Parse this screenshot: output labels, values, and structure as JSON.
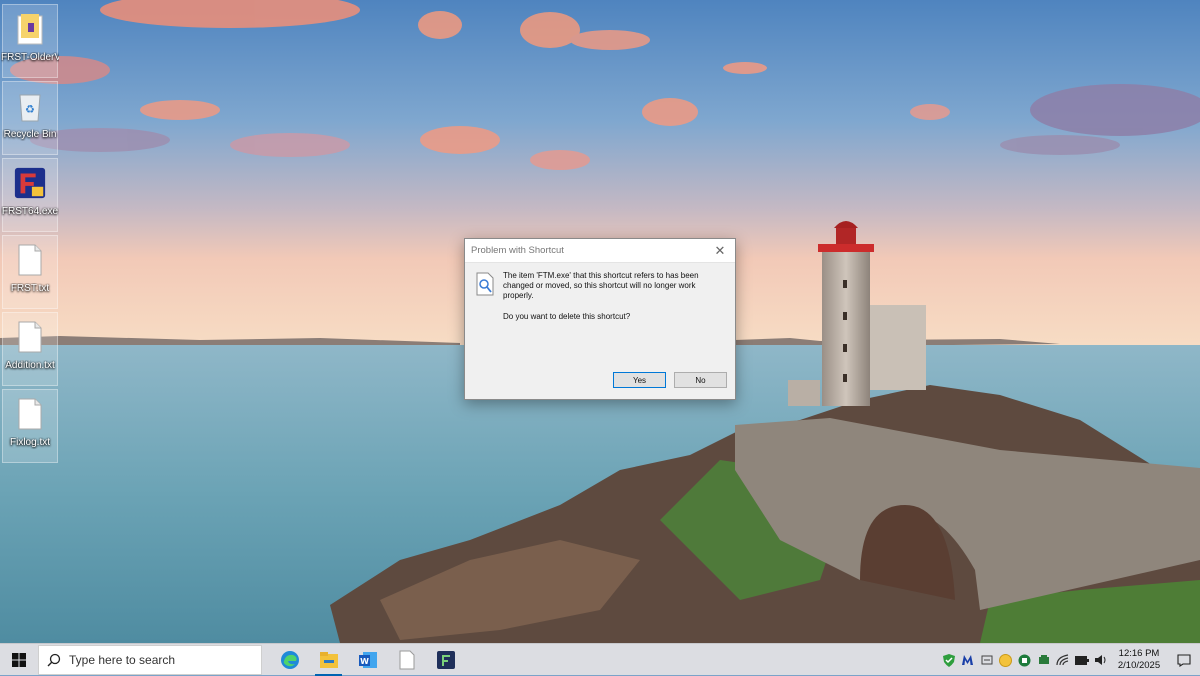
{
  "desktop": {
    "icons": [
      {
        "label": "FRST-OlderVersion",
        "icon": "folder-icon"
      },
      {
        "label": "Recycle Bin",
        "icon": "recycle-bin-icon"
      },
      {
        "label": "FRST64.exe",
        "icon": "frst-app-icon"
      },
      {
        "label": "FRST.txt",
        "icon": "text-file-icon"
      },
      {
        "label": "Addition.txt",
        "icon": "text-file-icon"
      },
      {
        "label": "Fixlog.txt",
        "icon": "text-file-icon"
      }
    ]
  },
  "dialog": {
    "title": "Problem with Shortcut",
    "close_glyph": "✕",
    "message": "The item 'FTM.exe' that this shortcut refers to has been changed or moved, so this shortcut will no longer work properly.",
    "question": "Do you want to delete this shortcut?",
    "yes_label": "Yes",
    "no_label": "No"
  },
  "taskbar": {
    "search_placeholder": "Type here to search",
    "apps": [
      "edge-icon",
      "file-explorer-icon",
      "word-icon",
      "notepad-icon",
      "frst-app-icon"
    ],
    "active_app": "file-explorer-icon",
    "tray_icons": [
      "defender-shield-icon",
      "malwarebytes-icon",
      "input-icon",
      "yellow-circle-icon",
      "security-icon",
      "chevron-icon",
      "network-icon",
      "battery-icon",
      "volume-icon"
    ],
    "clock_time": "12:16 PM",
    "clock_date": "2/10/2025"
  },
  "colors": {
    "accent": "#0078d7",
    "taskbar": "#dcdde2",
    "dialog_bg": "#f0f0f0"
  }
}
